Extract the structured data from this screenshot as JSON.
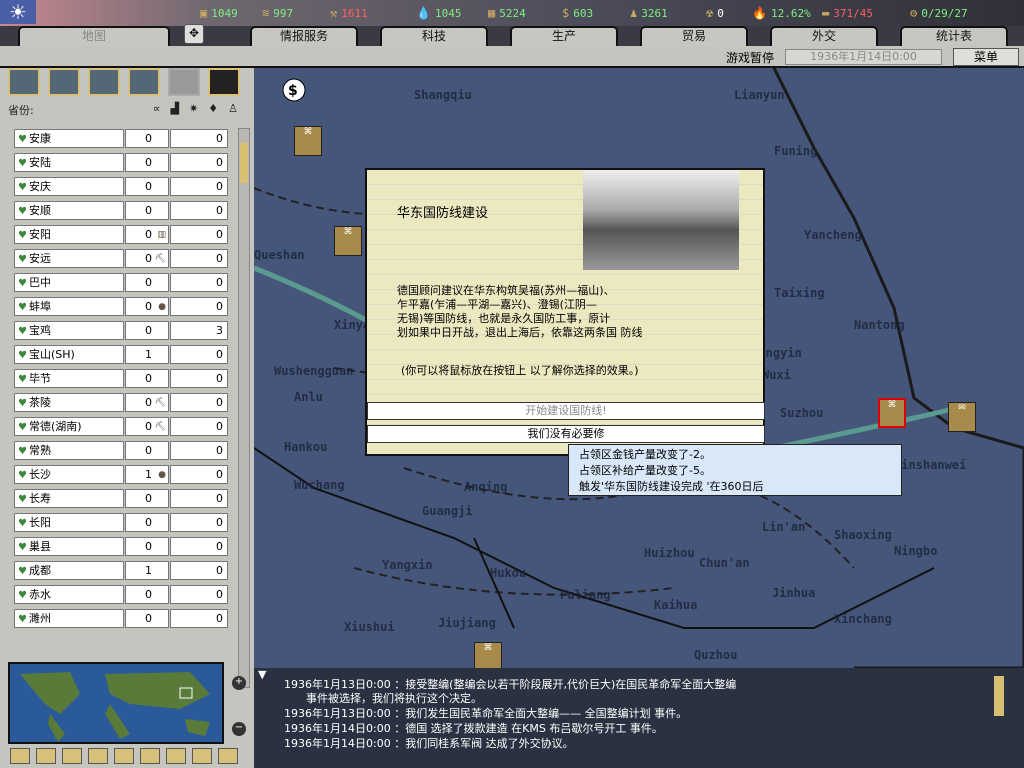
{
  "resources": [
    {
      "icon": "energy-icon",
      "value": "1049",
      "color": "#7ef07e"
    },
    {
      "icon": "metal-icon",
      "value": "997",
      "color": "#7ef07e"
    },
    {
      "icon": "rare-materials-icon",
      "value": "1611",
      "color": "#ff6060"
    },
    {
      "icon": "oil-icon",
      "value": "1045",
      "color": "#7ef07e"
    },
    {
      "icon": "supplies-icon",
      "value": "5224",
      "color": "#7ef07e"
    },
    {
      "icon": "money-icon",
      "value": "603",
      "color": "#7ef07e"
    },
    {
      "icon": "manpower-icon",
      "value": "3261",
      "color": "#7ef07e"
    },
    {
      "icon": "nuclear-icon",
      "value": "0",
      "color": "#ffffff"
    },
    {
      "icon": "dissent-icon",
      "value": "12.62%",
      "color": "#7ef07e"
    },
    {
      "icon": "transport-icon",
      "value": "371/45",
      "color": "#ff6060"
    },
    {
      "icon": "convoy-icon",
      "value": "0/29/27",
      "color": "#7ef07e"
    }
  ],
  "tabs": [
    "地图",
    "情报服务",
    "科技",
    "生产",
    "贸易",
    "外交",
    "统计表"
  ],
  "status": {
    "paused": "游戏暂停",
    "date": "1936年1月14日0:00",
    "menu": "菜单"
  },
  "left": {
    "header": "省份:",
    "provinces": [
      {
        "name": "安康",
        "a": "0",
        "b": "0"
      },
      {
        "name": "安陆",
        "a": "0",
        "b": "0"
      },
      {
        "name": "安庆",
        "a": "0",
        "b": "0"
      },
      {
        "name": "安顺",
        "a": "0",
        "b": "0"
      },
      {
        "name": "安阳",
        "a": "0",
        "b": "0"
      },
      {
        "name": "安远",
        "a": "0",
        "b": "0"
      },
      {
        "name": "巴中",
        "a": "0",
        "b": "0"
      },
      {
        "name": "蚌埠",
        "a": "0",
        "b": "0"
      },
      {
        "name": "宝鸡",
        "a": "0",
        "b": "3"
      },
      {
        "name": "宝山(SH)",
        "a": "1",
        "b": "0"
      },
      {
        "name": "毕节",
        "a": "0",
        "b": "0"
      },
      {
        "name": "茶陵",
        "a": "0",
        "b": "0"
      },
      {
        "name": "常德(湖南)",
        "a": "0",
        "b": "0"
      },
      {
        "name": "常熟",
        "a": "0",
        "b": "0"
      },
      {
        "name": "长沙",
        "a": "1",
        "b": "0"
      },
      {
        "name": "长寿",
        "a": "0",
        "b": "0"
      },
      {
        "name": "长阳",
        "a": "0",
        "b": "0"
      },
      {
        "name": "巢县",
        "a": "0",
        "b": "0"
      },
      {
        "name": "成都",
        "a": "1",
        "b": "0"
      },
      {
        "name": "赤水",
        "a": "0",
        "b": "0"
      },
      {
        "name": "濉州",
        "a": "0",
        "b": "0"
      }
    ]
  },
  "map_labels": [
    "Shangqiu",
    "Lianyun",
    "Funing",
    "Yancheng",
    "Taixing",
    "Nantong",
    "Jiangyin",
    "Wuxi",
    "Suzhou",
    "Jinshanwei",
    "Hankou",
    "Wuchang",
    "Anlu",
    "Xinyang",
    "Anqing",
    "Guangji",
    "Huizhou",
    "Chun'an",
    "Ningbo",
    "Shaoxing",
    "Lin'an",
    "Hukou",
    "Fuliang",
    "Kaihua",
    "Jinhua",
    "Xinchang",
    "Quzhou",
    "Xiushui",
    "Jiujiang",
    "Yangxin",
    "Wushengguan",
    "Queshan"
  ],
  "event": {
    "title": "华东国防线建设",
    "text": "德国顾问建议在华东构筑吴福(苏州—福山)、\n乍平嘉(乍浦—平湖—嘉兴)、澄锡(江阴—\n无锡)等国防线，也就是永久国防工事，原计\n划如果中日开战，退出上海后，依靠这两条国 防线",
    "hint": "(你可以将鼠标放在按钮上 以了解你选择的效果。)",
    "option_a": "开始建设国防线!",
    "option_b": "我们没有必要修"
  },
  "tooltip": [
    "占领区金钱产量改变了-2。",
    "占领区补给产量改变了-5。",
    "触发'华东国防线建设完成 '在360日后"
  ],
  "log": [
    "1936年1月13日0:00  ：接受整编(整编会以若干阶段展开,代价巨大)在国民革命军全面大整编",
    "事件被选择，我们将执行这个决定。",
    "1936年1月13日0:00  ：我们发生国民革命军全面大整编—— 全国整编计划 事件。",
    "1936年1月14日0:00  ：德国 选择了拨款建造 在KMS 布吕歇尔号开工 事件。",
    "1936年1月14日0:00  ：我们同桂系军阀 达成了外交协议。"
  ]
}
